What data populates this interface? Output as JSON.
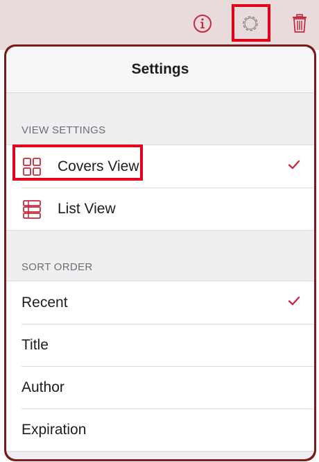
{
  "popover": {
    "title": "Settings"
  },
  "view_settings": {
    "label": "VIEW SETTINGS",
    "items": [
      {
        "label": "Covers View",
        "icon": "grid-icon",
        "selected": true
      },
      {
        "label": "List View",
        "icon": "list-icon",
        "selected": false
      }
    ]
  },
  "sort_order": {
    "label": "SORT ORDER",
    "items": [
      {
        "label": "Recent",
        "selected": true
      },
      {
        "label": "Title",
        "selected": false
      },
      {
        "label": "Author",
        "selected": false
      },
      {
        "label": "Expiration",
        "selected": false
      }
    ]
  },
  "toolbar": {
    "icons": [
      "info-icon",
      "gear-icon",
      "trash-icon"
    ]
  },
  "colors": {
    "accent": "#c8283c",
    "highlight": "#e3001b",
    "popover_border": "#7a1a1a",
    "toolbar_bg": "#e9dbdb"
  }
}
